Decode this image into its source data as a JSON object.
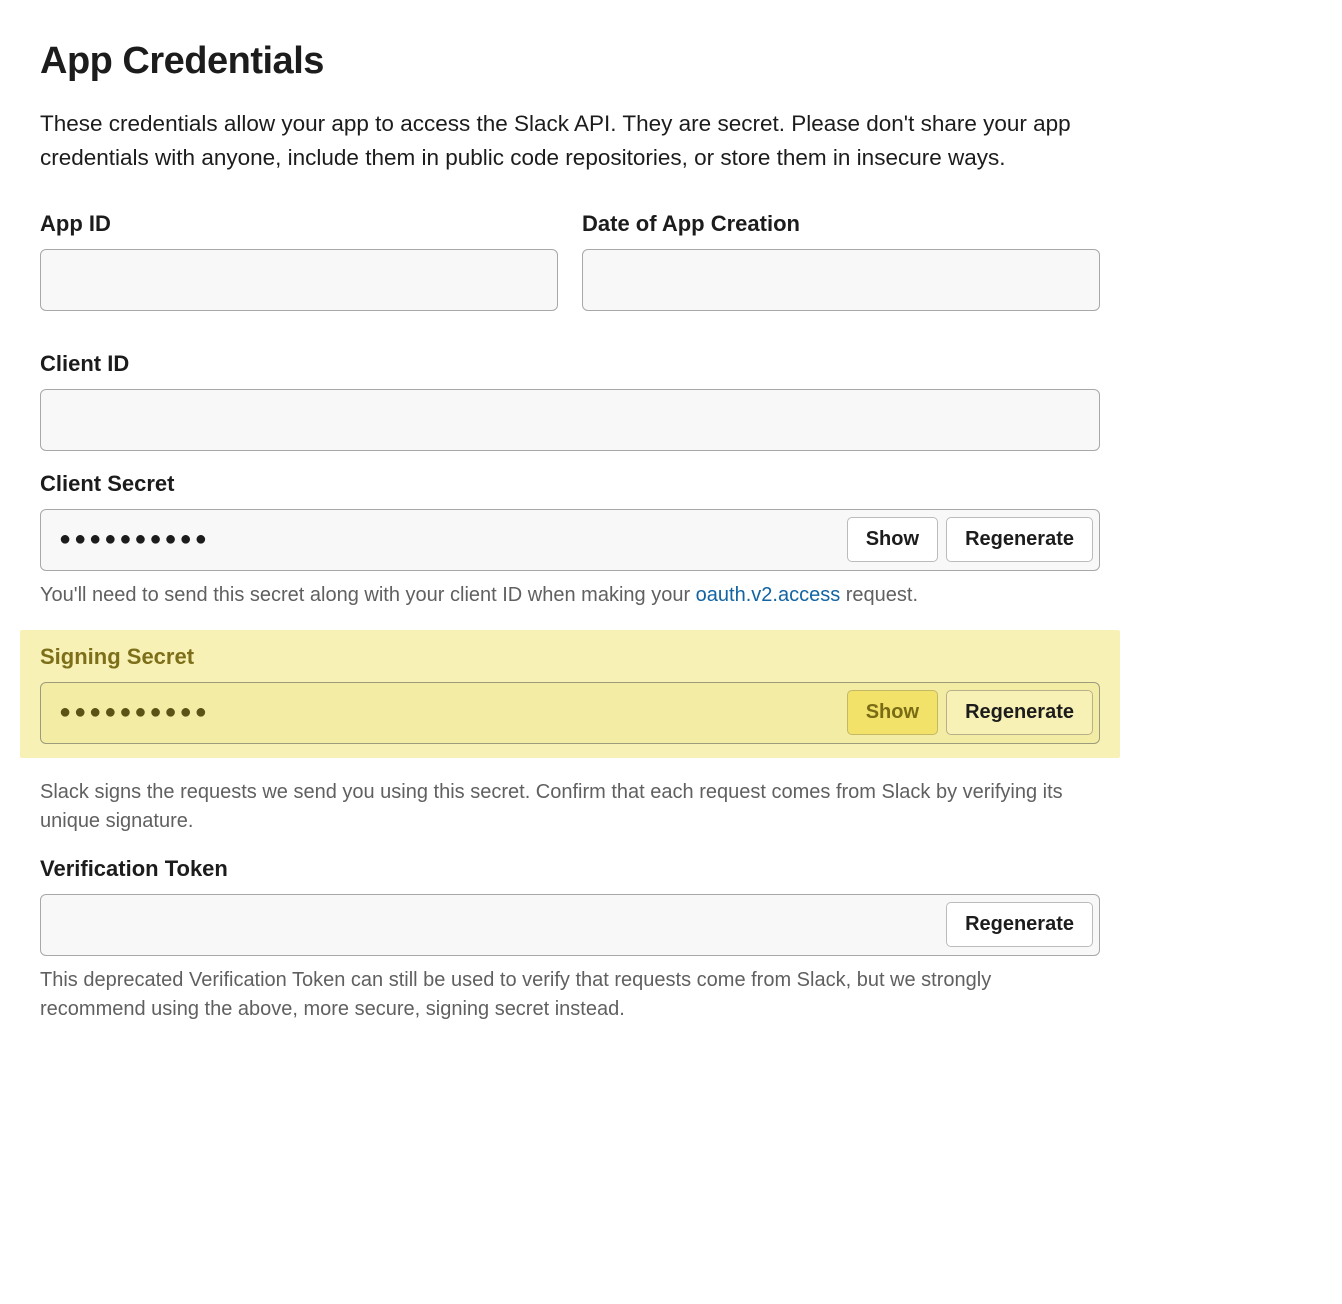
{
  "page": {
    "title": "App Credentials",
    "description": "These credentials allow your app to access the Slack API. They are secret. Please don't share your app credentials with anyone, include them in public code repositories, or store them in insecure ways."
  },
  "fields": {
    "app_id": {
      "label": "App ID",
      "value": ""
    },
    "date_creation": {
      "label": "Date of App Creation",
      "value": ""
    },
    "client_id": {
      "label": "Client ID",
      "value": ""
    },
    "client_secret": {
      "label": "Client Secret",
      "masked": "●●●●●●●●●●",
      "help_prefix": "You'll need to send this secret along with your client ID when making your ",
      "help_link": "oauth.v2.access",
      "help_suffix": " request."
    },
    "signing_secret": {
      "label": "Signing Secret",
      "masked": "●●●●●●●●●●",
      "help": "Slack signs the requests we send you using this secret. Confirm that each request comes from Slack by verifying its unique signature."
    },
    "verification_token": {
      "label": "Verification Token",
      "value": "",
      "help": "This deprecated Verification Token can still be used to verify that requests come from Slack, but we strongly recommend using the above, more secure, signing secret instead."
    }
  },
  "buttons": {
    "show": "Show",
    "regenerate": "Regenerate"
  }
}
